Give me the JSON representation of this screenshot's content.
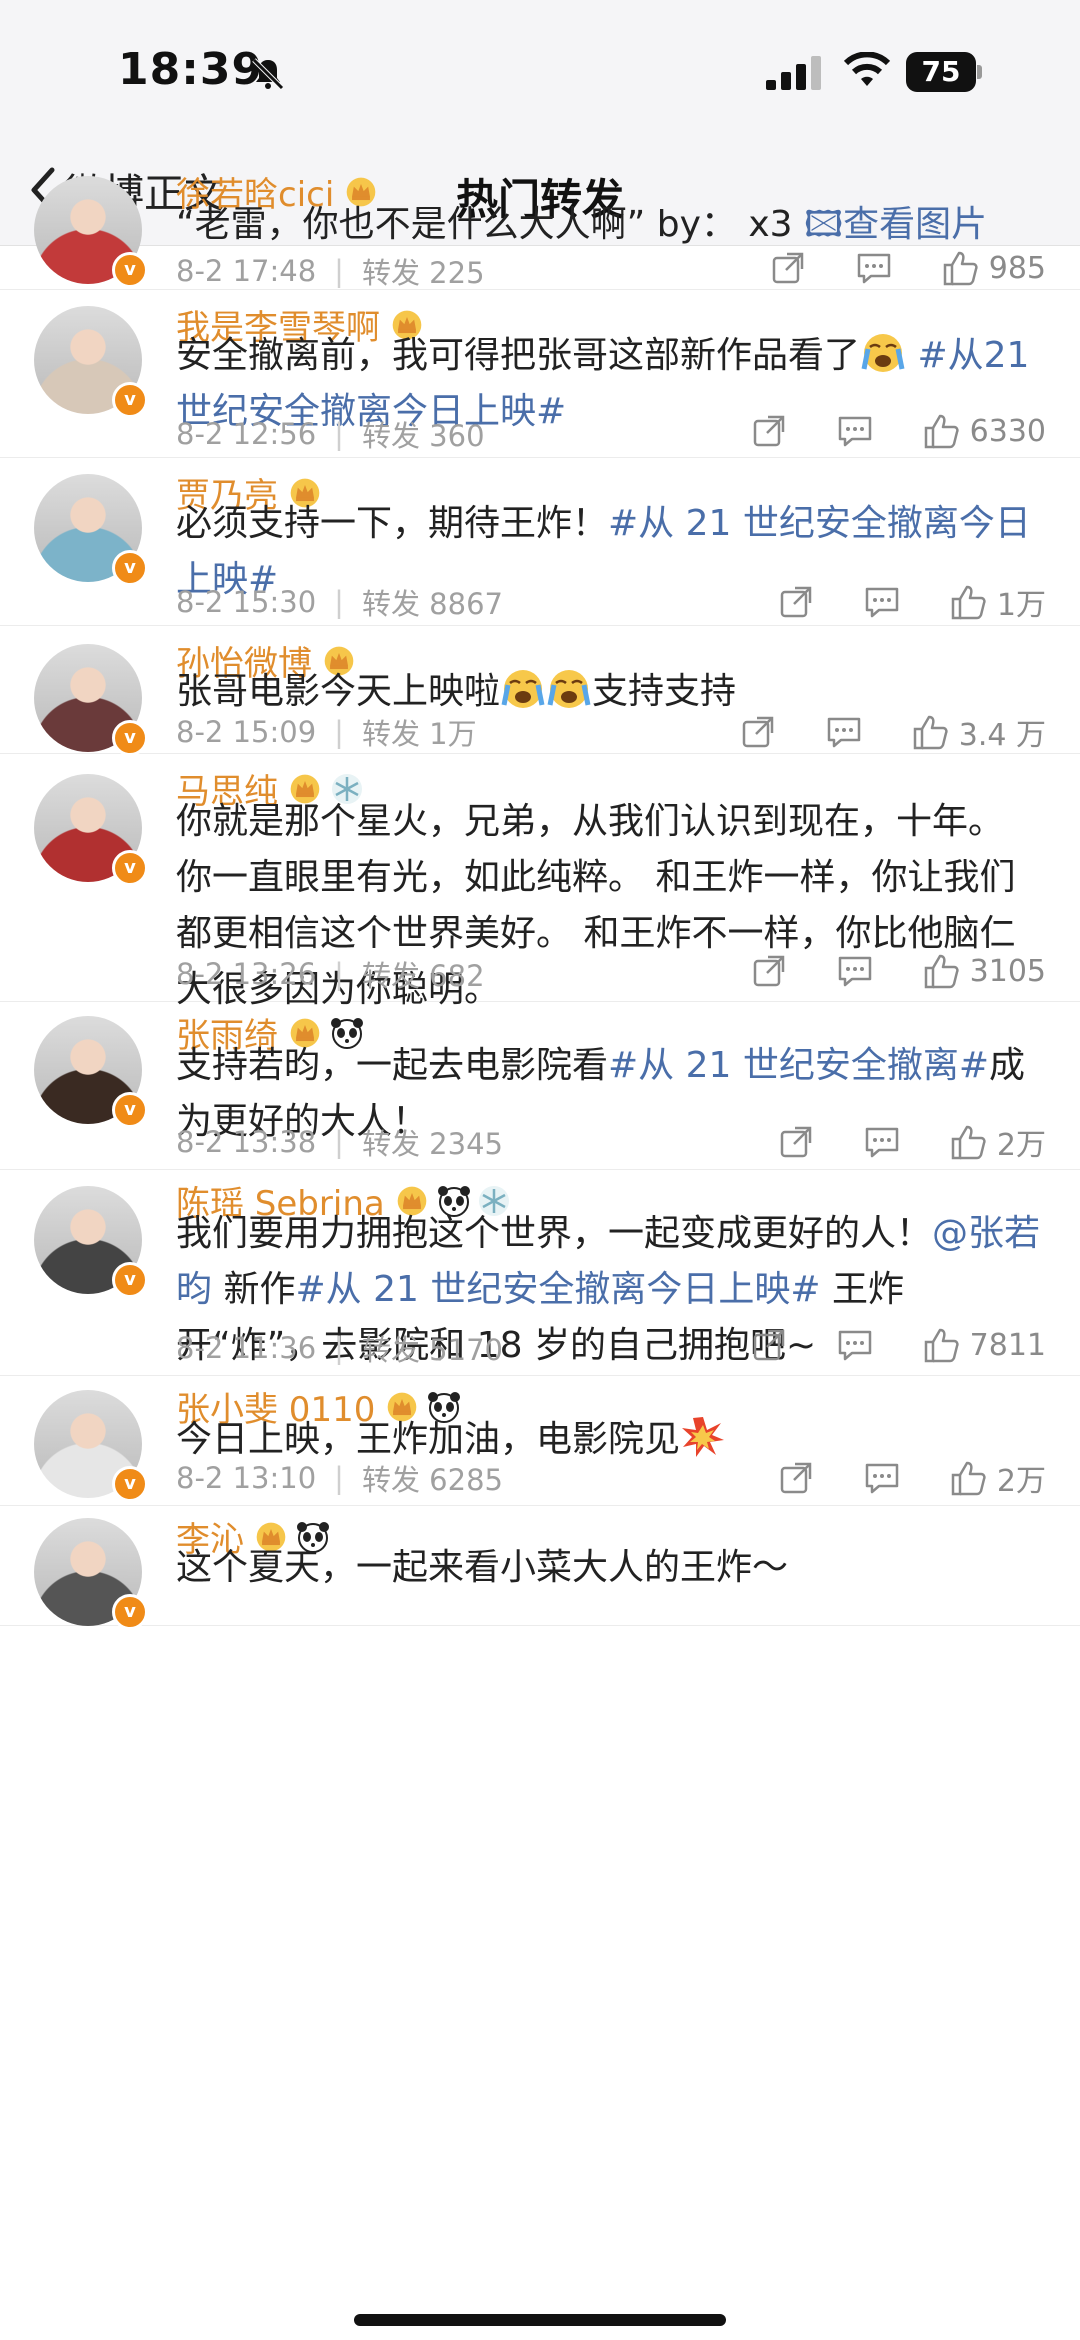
{
  "status_bar": {
    "time": "18:39",
    "battery": "75"
  },
  "nav": {
    "back_label": "微博正文",
    "title": "热门转发"
  },
  "reposts": [
    {
      "name": "徐若晗cici",
      "parts": [
        [
          "t",
          "“老雷，你也不是什么大人啊” by： x3 "
        ],
        [
          "tag",
          "🖾查看图片"
        ]
      ],
      "date": "8-2 17:48",
      "forward": "转发 225",
      "likes": "985"
    },
    {
      "name": "我是李雪琴啊",
      "parts": [
        [
          "t",
          "安全撤离前，我可得把张哥这部新作品看了"
        ],
        [
          "emoji",
          "😭"
        ],
        [
          "tag",
          " #从21世纪安全撤离今日上映#"
        ]
      ],
      "date": "8-2 12:56",
      "forward": "转发 360",
      "likes": "6330"
    },
    {
      "name": "贾乃亮",
      "parts": [
        [
          "t",
          "必须支持一下，期待王炸！"
        ],
        [
          "tag",
          "#从 21 世纪安全撤离今日上映#"
        ]
      ],
      "date": "8-2 15:30",
      "forward": "转发 8867",
      "likes": "1万"
    },
    {
      "name": "孙怡微博",
      "parts": [
        [
          "t",
          "张哥电影今天上映啦"
        ],
        [
          "emoji",
          "😭"
        ],
        [
          "emoji",
          "😭"
        ],
        [
          "t",
          "支持支持"
        ]
      ],
      "date": "8-2 15:09",
      "forward": "转发 1万",
      "likes": "3.4 万"
    },
    {
      "name": "马思纯",
      "parts": [
        [
          "t",
          "你就是那个星火，兄弟，从我们认识到现在，十年。 你一直眼里有光，如此纯粹。 和王炸一样，你让我们都更相信这个世界美好。 和王炸不一样，你比他脑仁大很多因为你聪明。"
        ]
      ],
      "date": "8-2 13:26",
      "forward": "转发 682",
      "likes": "3105"
    },
    {
      "name": "张雨绮",
      "parts": [
        [
          "t",
          "支持若昀，一起去电影院看"
        ],
        [
          "tag",
          "#从 21 世纪安全撤离#"
        ],
        [
          "t",
          "成为更好的大人！"
        ]
      ],
      "date": "8-2 13:38",
      "forward": "转发 2345",
      "likes": "2万"
    },
    {
      "name": "陈瑶 Sebrina",
      "parts": [
        [
          "t",
          "我们要用力拥抱这个世界，一起变成更好的人！"
        ],
        [
          "tag",
          "@张若昀"
        ],
        [
          "t",
          " 新作"
        ],
        [
          "tag",
          "#从 21 世纪安全撤离今日上映#"
        ],
        [
          "t",
          " 王炸开“炸”，去影院和 18 岁的自己拥抱吧~"
        ]
      ],
      "date": "8-2 11:36",
      "forward": "转发 5170",
      "likes": "7811"
    },
    {
      "name": "张小斐 0110",
      "parts": [
        [
          "t",
          "今日上映，王炸加油，电影院见"
        ],
        [
          "emoji",
          "💥"
        ]
      ],
      "date": "8-2 13:10",
      "forward": "转发 6285",
      "likes": "2万"
    },
    {
      "name": "李沁",
      "parts": [
        [
          "t",
          "这个夏天，一起来看小菜大人的王炸～"
        ]
      ],
      "date": "",
      "forward": "",
      "likes": ""
    }
  ],
  "colors": {
    "name": "#e08d2d",
    "hashtag": "#4a6ea9",
    "meta": "#a0a0a0",
    "badge": "#f08b17"
  },
  "icons": {
    "crown": "crown-icon",
    "panda": "panda-icon",
    "snowflake": "snowflake-icon",
    "repost": "repost-icon",
    "comment": "comment-icon",
    "like": "like-icon"
  }
}
